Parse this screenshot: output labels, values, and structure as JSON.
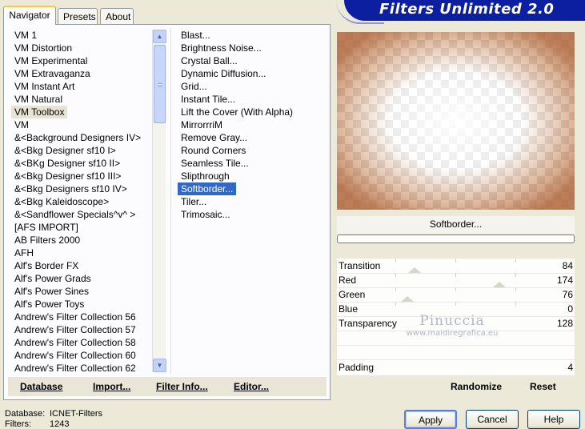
{
  "tabs": [
    "Navigator",
    "Presets",
    "About"
  ],
  "banner_title": "Filters Unlimited 2.0",
  "categories": [
    "VM 1",
    "VM Distortion",
    "VM Experimental",
    "VM Extravaganza",
    "VM Instant Art",
    "VM Natural",
    "VM Toolbox",
    "VM",
    "&<Background Designers IV>",
    "&<Bkg Designer sf10 I>",
    "&<BKg Designer sf10 II>",
    "&<Bkg Designer sf10 III>",
    "&<Bkg Designers sf10 IV>",
    "&<Bkg Kaleidoscope>",
    "&<Sandflower Specials^v^ >",
    "[AFS IMPORT]",
    "AB Filters 2000",
    "AFH",
    "Alf's Border FX",
    "Alf's Power Grads",
    "Alf's Power Sines",
    "Alf's Power Toys",
    "Andrew's Filter Collection 56",
    "Andrew's Filter Collection 57",
    "Andrew's Filter Collection 58",
    "Andrew's Filter Collection 60",
    "Andrew's Filter Collection 62"
  ],
  "selected_category": "VM Toolbox",
  "filters": [
    "Blast...",
    "Brightness Noise...",
    "Crystal Ball...",
    "Dynamic Diffusion...",
    "Grid...",
    "Instant Tile...",
    "Lift the Cover (With Alpha)",
    "MirrorrriM",
    "Remove Gray...",
    "Round Corners",
    "Seamless Tile...",
    "Slipthrough",
    "Softborder...",
    "Tiler...",
    "Trimosaic..."
  ],
  "selected_filter": "Softborder...",
  "bottom_buttons": {
    "database": "Database",
    "import": "Import...",
    "filter_info": "Filter Info...",
    "editor": "Editor..."
  },
  "filter_name": "Softborder...",
  "params": [
    {
      "label": "Transition",
      "value": "84"
    },
    {
      "label": "Red",
      "value": "174"
    },
    {
      "label": "Green",
      "value": "76"
    },
    {
      "label": "Blue",
      "value": "0"
    },
    {
      "label": "Transparency",
      "value": "128"
    }
  ],
  "padding": {
    "label": "Padding",
    "value": "4"
  },
  "watermark": {
    "line1": "Pinuccia",
    "line2": "www.maidiregrafica.eu"
  },
  "randomize_label": "Randomize",
  "reset_label": "Reset",
  "status": {
    "database_key": "Database:",
    "database_value": "ICNET-Filters",
    "filters_key": "Filters:",
    "filters_value": "1243"
  },
  "dialog_buttons": {
    "apply": "Apply",
    "cancel": "Cancel",
    "help": "Help"
  },
  "colors": {
    "banner": "#0b1fa0",
    "selection": "#316ac5",
    "preview_border": "#cb8e64"
  }
}
